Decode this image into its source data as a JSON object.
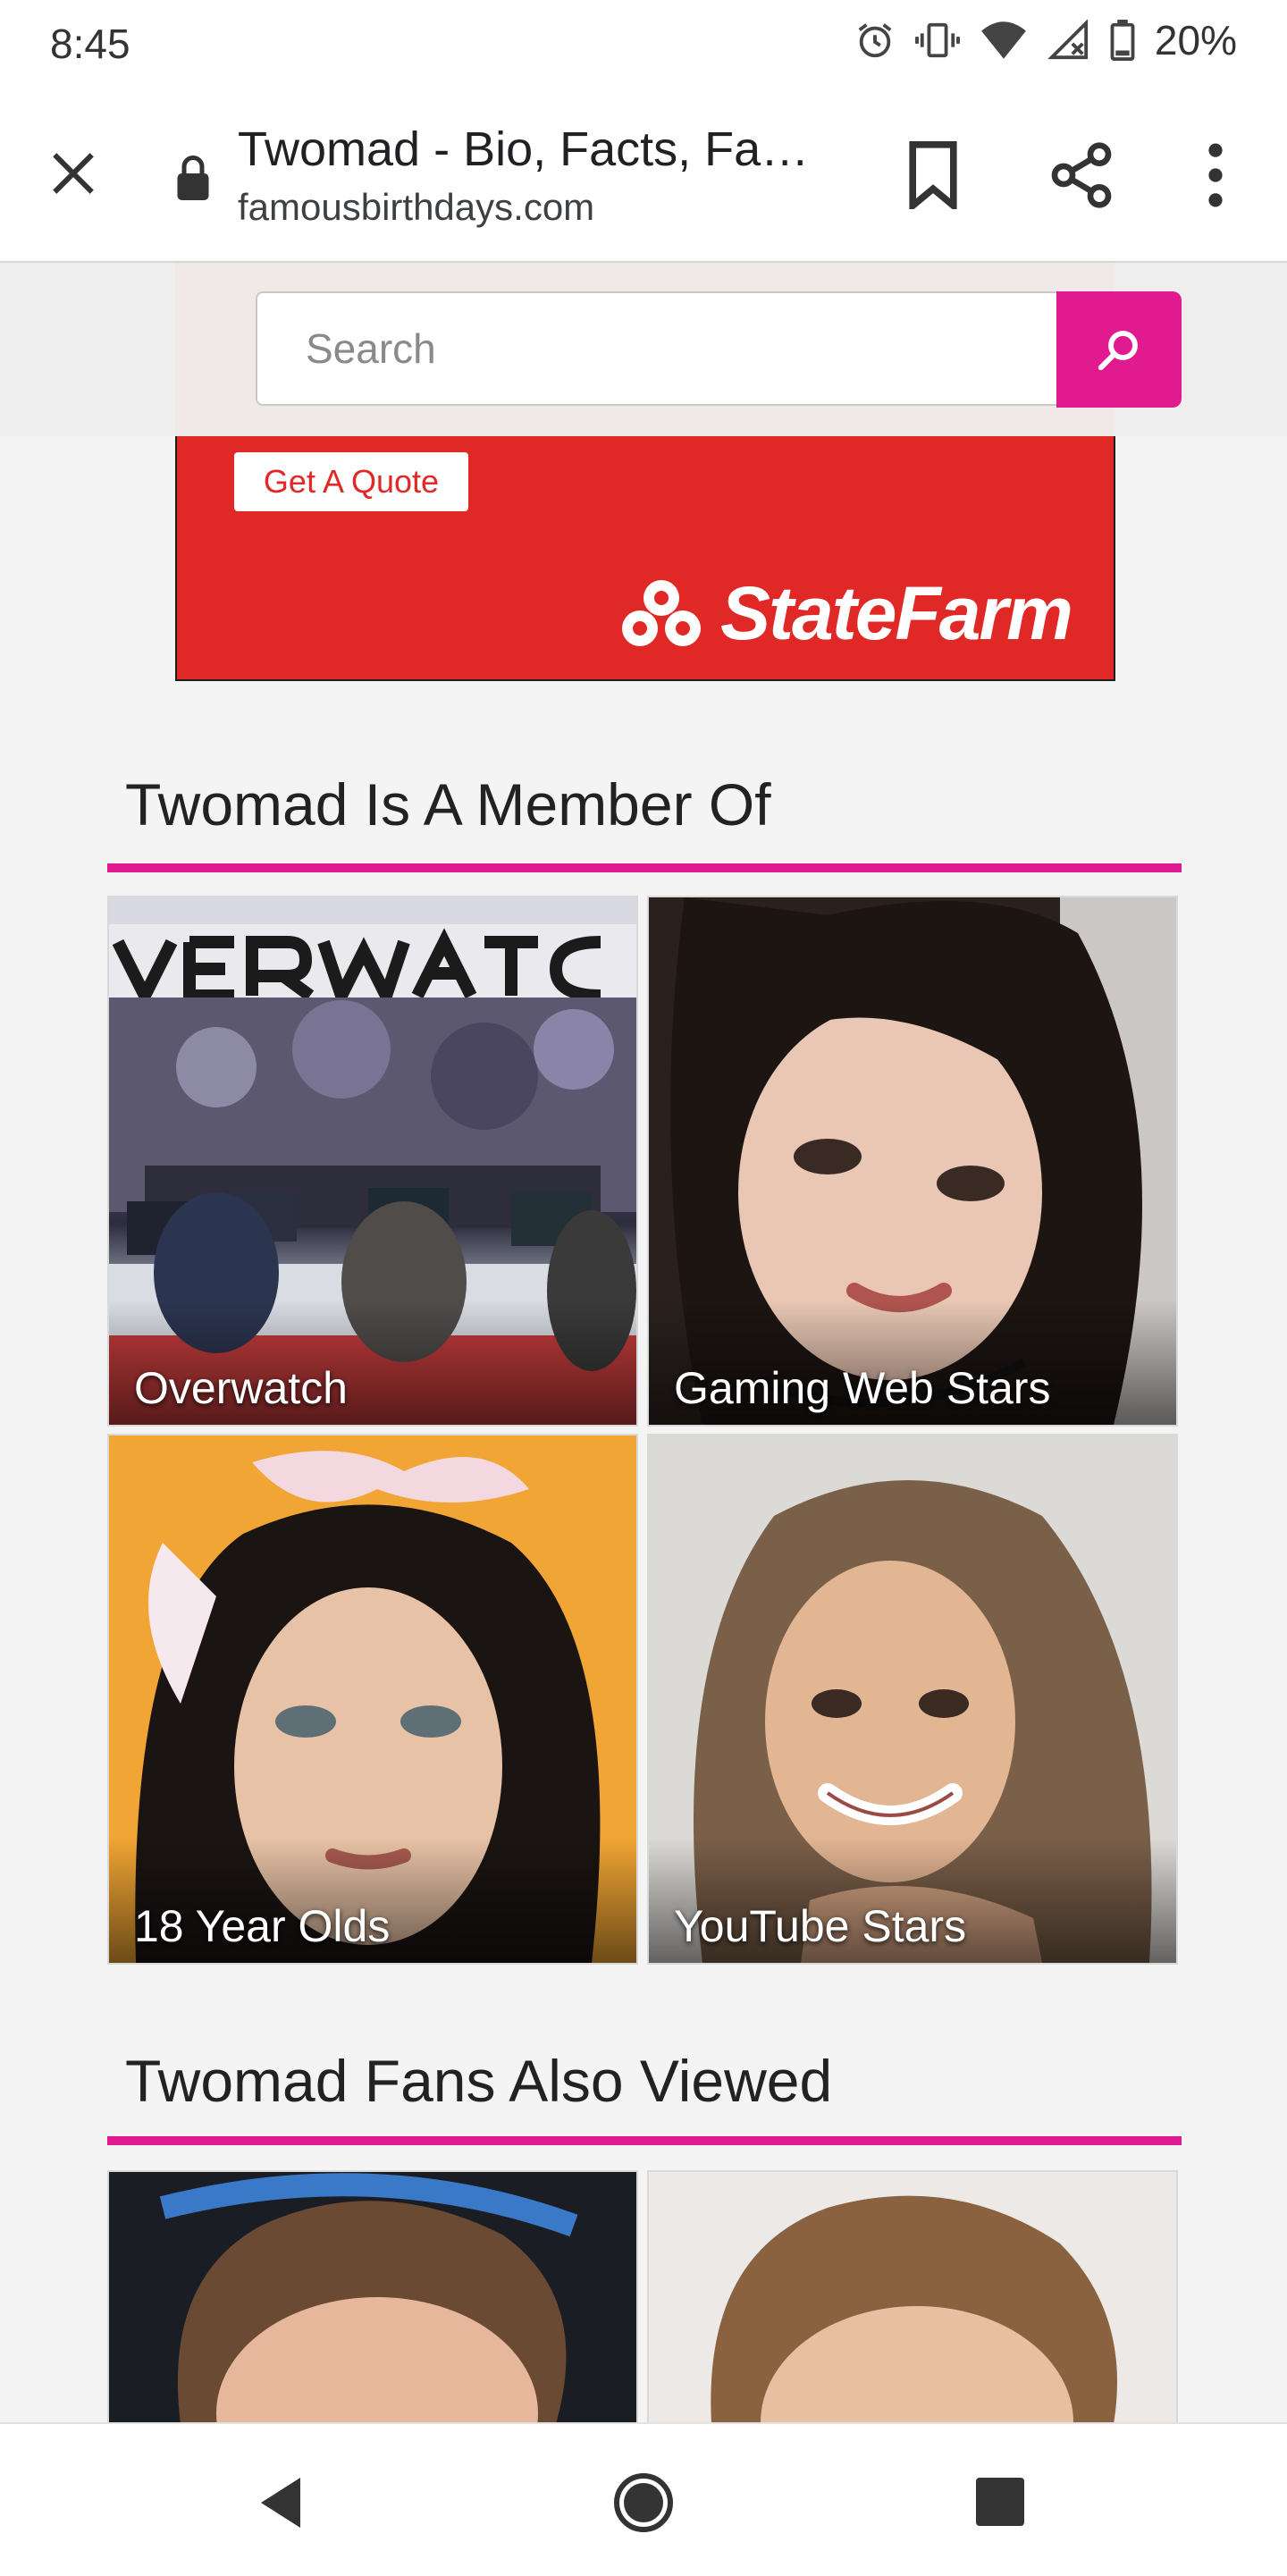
{
  "status_bar": {
    "time": "8:45",
    "battery": "20%",
    "icons": [
      "alarm-icon",
      "vibrate-icon",
      "wifi-icon",
      "signal-icon",
      "battery-icon"
    ]
  },
  "toolbar": {
    "title": "Twomad - Bio, Facts, Fa…",
    "url": "famousbirthdays.com"
  },
  "search": {
    "placeholder": "Search"
  },
  "ad": {
    "cta_label": "Get A Quote",
    "brand": "StateFarm",
    "brand_color": "#e02826"
  },
  "member_section": {
    "title": "Twomad Is A Member Of",
    "tiles": [
      {
        "label": "Overwatch"
      },
      {
        "label": "Gaming Web Stars"
      },
      {
        "label": "18 Year Olds"
      },
      {
        "label": "YouTube Stars"
      }
    ]
  },
  "fans_section": {
    "title": "Twomad Fans Also Viewed"
  },
  "colors": {
    "accent": "#e21a8f"
  }
}
